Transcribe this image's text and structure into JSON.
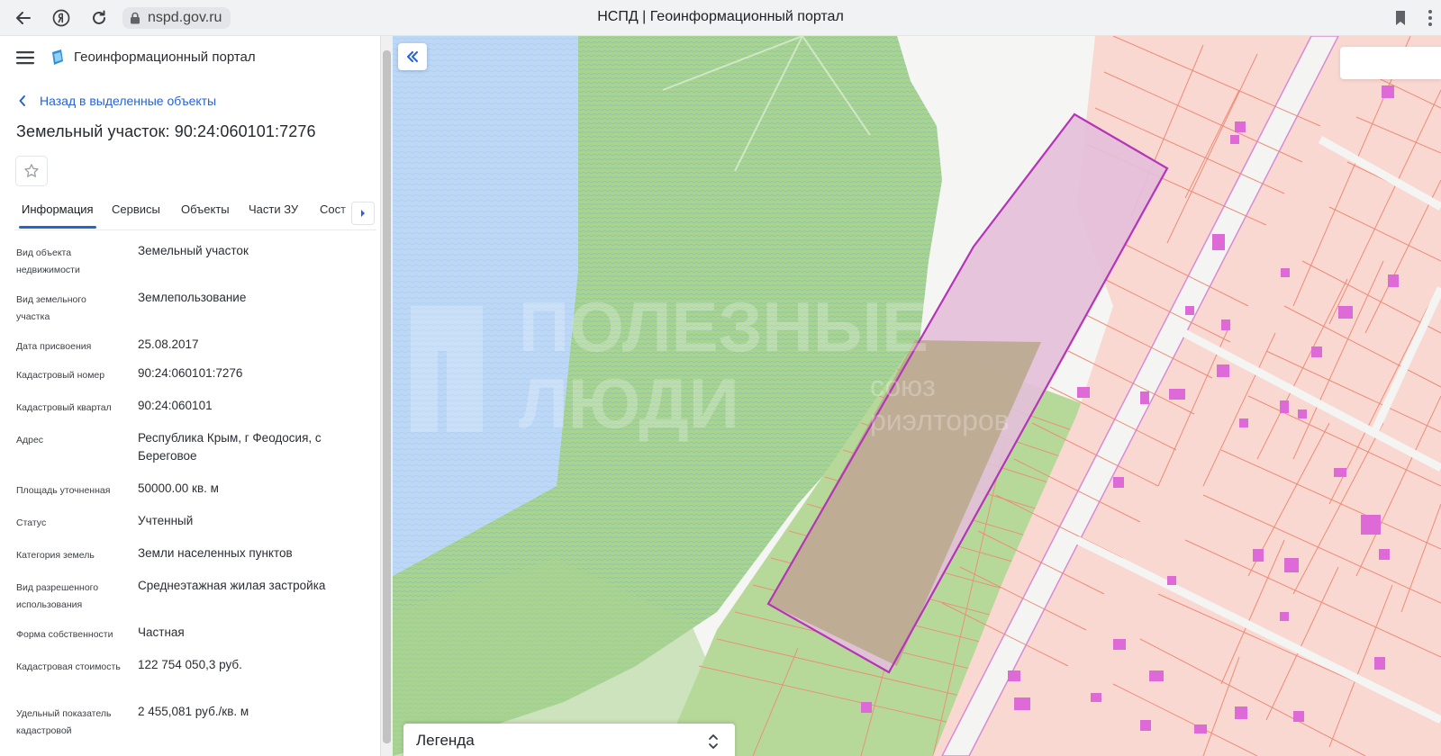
{
  "browser": {
    "url": "nspd.gov.ru",
    "window_title": "НСПД | Геоинформационный портал",
    "icons": [
      "back-arrow-icon",
      "yandex-icon",
      "reload-icon",
      "lock-icon",
      "bookmark-icon",
      "more-dots-icon"
    ]
  },
  "sidebar": {
    "portal_name": "Геоинформационный портал",
    "back_link": "Назад в выделенные объекты",
    "object_title": "Земельный участок: 90:24:060101:7276",
    "tabs": [
      "Информация",
      "Сервисы",
      "Объекты",
      "Части ЗУ",
      "Сост"
    ],
    "active_tab": "Информация",
    "properties": [
      {
        "label": "Вид объекта недвижимости",
        "value": "Земельный участок"
      },
      {
        "label": "Вид земельного участка",
        "value": "Землепользование"
      },
      {
        "label": "Дата присвоения",
        "value": "25.08.2017"
      },
      {
        "label": "Кадастровый номер",
        "value": "90:24:060101:7276"
      },
      {
        "label": "Кадастровый квартал",
        "value": "90:24:060101"
      },
      {
        "label": "Адрес",
        "value": "Республика Крым, г Феодосия, с Береговое"
      },
      {
        "label": "Площадь уточненная",
        "value": "50000.00 кв. м"
      },
      {
        "label": "Статус",
        "value": "Учтенный"
      },
      {
        "label": "Категория земель",
        "value": "Земли населенных пунктов"
      },
      {
        "label": "Вид разрешенного использования",
        "value": "Среднеэтажная жилая застройка"
      },
      {
        "label": "Форма собственности",
        "value": "Частная"
      },
      {
        "label": "Кадастровая стоимость",
        "value": "122 754 050,3 руб."
      },
      {
        "label": "Удельный показатель кадастровой",
        "value": "2 455,081 руб./кв. м"
      }
    ]
  },
  "map": {
    "legend_label": "Легенда",
    "watermark_lines": [
      "ПОЛЕЗНЫЕ",
      "ЛЮДИ"
    ],
    "watermark_sub": [
      "союз",
      "риэлторов"
    ],
    "colors": {
      "water": "#bcd8f6",
      "greenery": "#a9d48f",
      "parcel_fill": "#f9d8d2",
      "parcel_line": "#ee8b76",
      "building": "#dd6ad6",
      "selected_outline": "#b534b8",
      "accent": "#2563d6"
    }
  }
}
